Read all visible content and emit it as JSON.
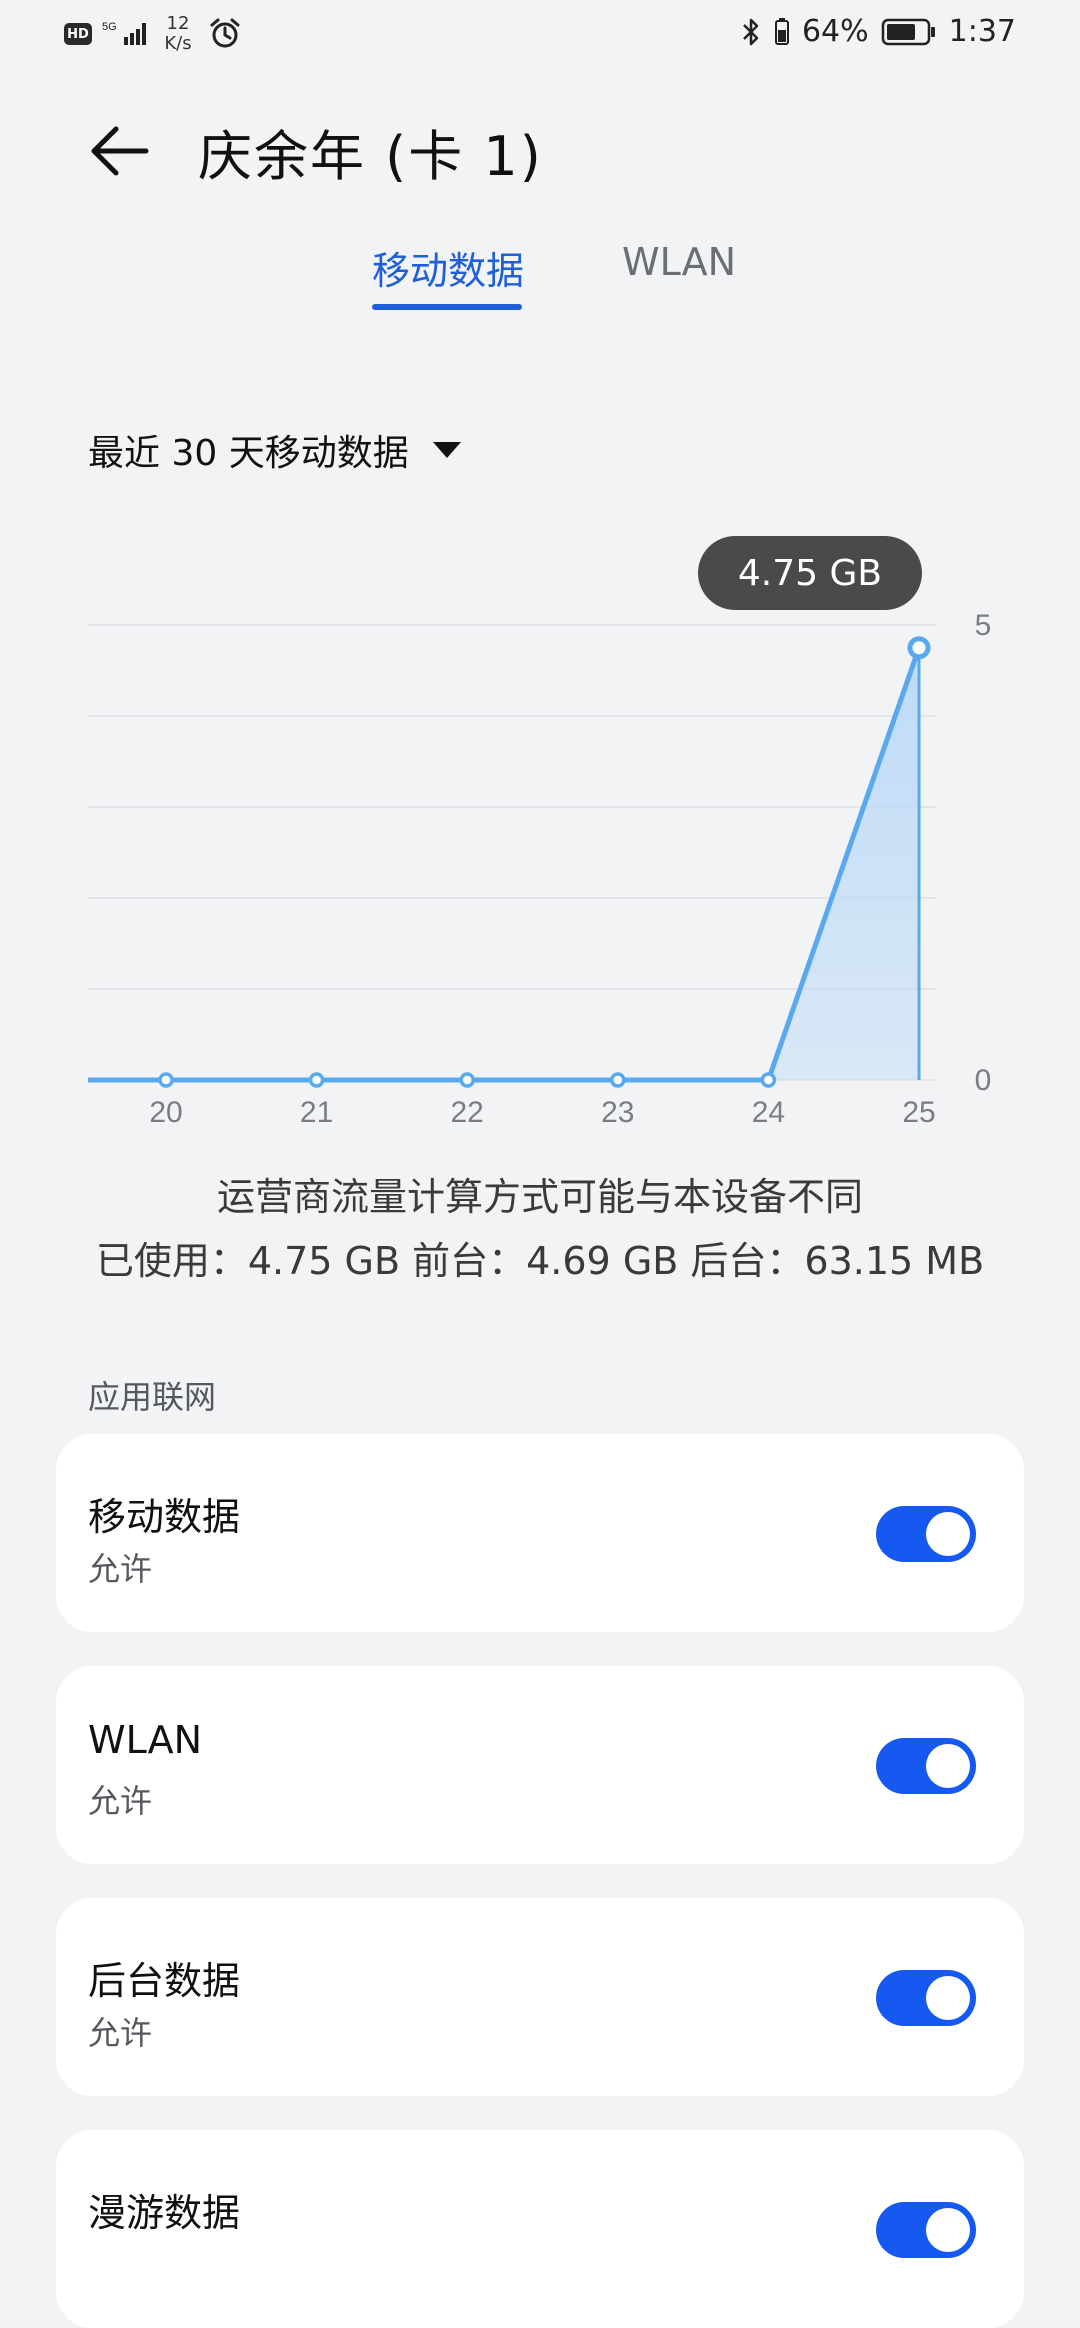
{
  "status_bar": {
    "hd": "HD",
    "signal": "5G",
    "speed_value": "12",
    "speed_unit": "K/s",
    "battery": "64%",
    "time": "1:37"
  },
  "header": {
    "title": "庆余年 (卡 1)"
  },
  "tabs": {
    "mobile": "移动数据",
    "wlan": "WLAN"
  },
  "period": {
    "label": "最近 30 天移动数据"
  },
  "chart_data": {
    "type": "area",
    "x": [
      20,
      21,
      22,
      23,
      24,
      25
    ],
    "values": [
      0,
      0,
      0,
      0,
      0,
      4.75
    ],
    "x_tick_labels": [
      "20",
      "21",
      "22",
      "23",
      "24",
      "25"
    ],
    "y_tick_labels": [
      "5",
      "0"
    ],
    "ylim": [
      0,
      5
    ],
    "tooltip": "4.75 GB",
    "line_color": "#5aa9ee",
    "fill_color": "#bcdaf8",
    "grid": true
  },
  "notes": {
    "line1": "运营商流量计算方式可能与本设备不同",
    "line2": "已使用：4.75 GB 前台：4.69 GB 后台：63.15 MB"
  },
  "section": {
    "title": "应用联网"
  },
  "settings": [
    {
      "title": "移动数据",
      "subtitle": "允许",
      "enabled": true
    },
    {
      "title": "WLAN",
      "subtitle": "允许",
      "enabled": true
    },
    {
      "title": "后台数据",
      "subtitle": "允许",
      "enabled": true
    },
    {
      "title": "漫游数据",
      "subtitle": "",
      "enabled": true
    }
  ],
  "colors": {
    "accent": "#1f5fd8",
    "toggle_on": "#1559f0",
    "background": "#f1f3f5"
  }
}
